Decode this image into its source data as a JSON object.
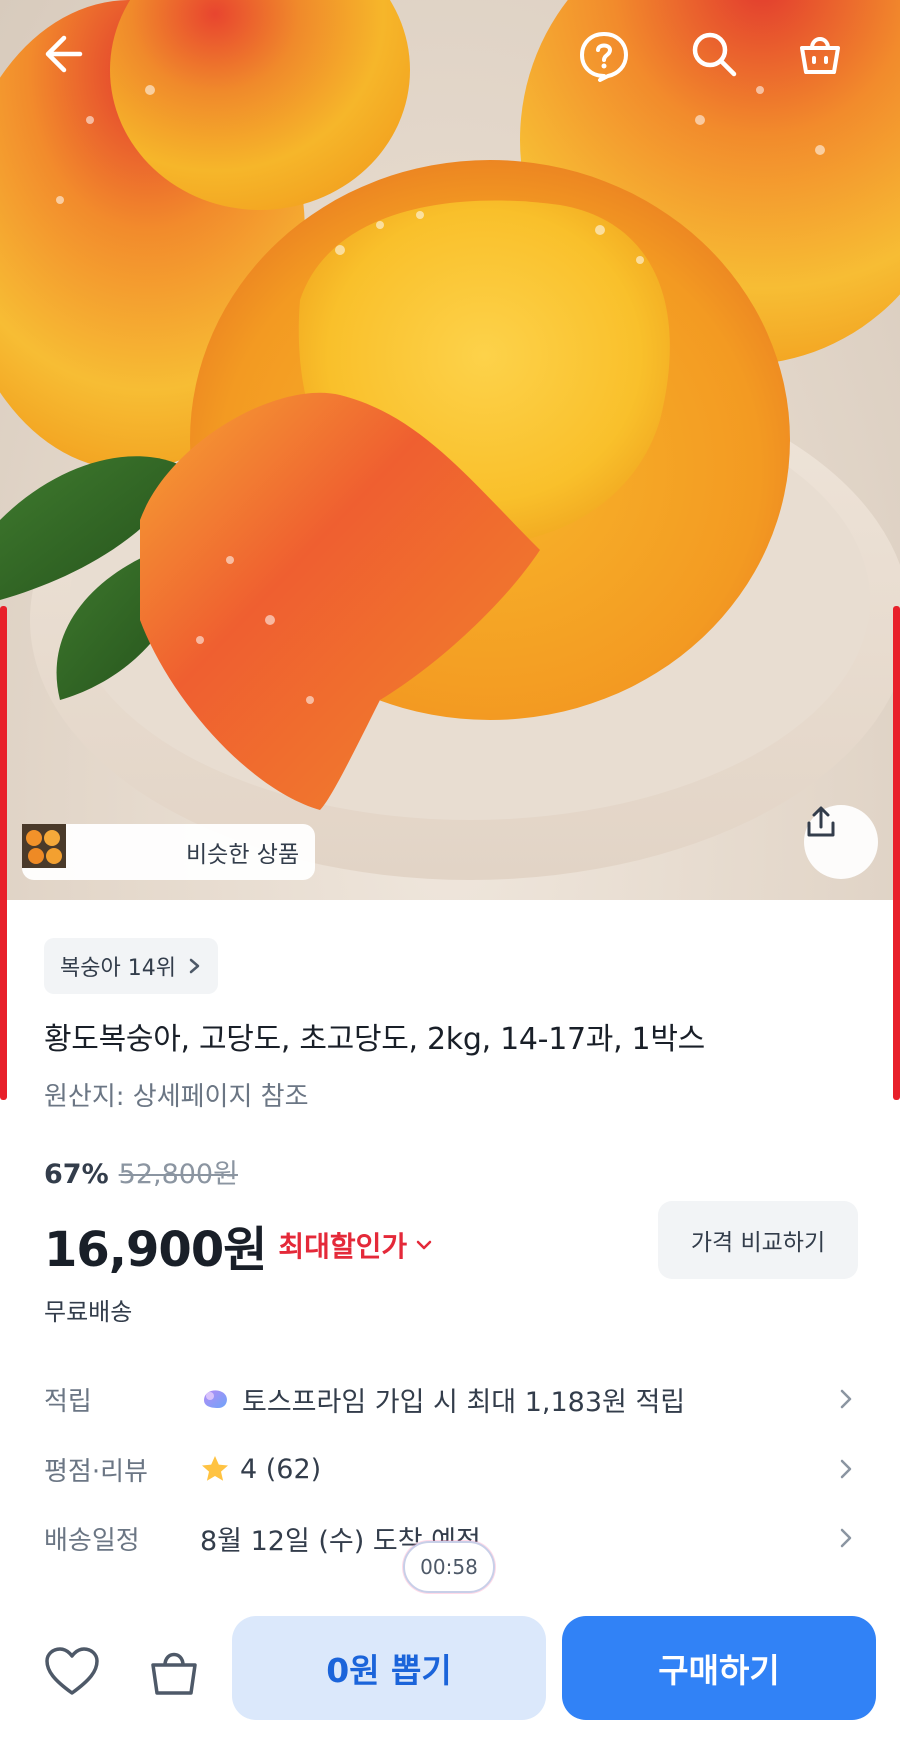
{
  "header": {
    "icons": [
      "back-arrow-icon",
      "help-icon",
      "search-icon",
      "cart-icon"
    ]
  },
  "hero": {
    "similar_label": "비슷한 상품",
    "share_icon": "share-icon"
  },
  "product": {
    "rank": "복숭아 14위",
    "title": "황도복숭아, 고당도, 초고당도, 2kg, 14-17과, 1박스",
    "origin": "원산지: 상세페이지 참조",
    "discount_rate": "67%",
    "original_price": "52,800원",
    "price": "16,900원",
    "max_discount_label": "최대할인가",
    "compare_label": "가격 비교하기",
    "shipping": "무료배송"
  },
  "details": {
    "points_label": "적립",
    "points_value": "토스프라임 가입 시 최대 1,183원 적립",
    "rating_label": "평점·리뷰",
    "rating_value": "4 (62)",
    "delivery_label": "배송일정",
    "delivery_value": "8월 12일 (수) 도착 예정"
  },
  "timer": "00:58",
  "bottom_bar": {
    "draw_label": "0원 뽑기",
    "buy_label": "구매하기"
  },
  "colors": {
    "accent": "#3182f6",
    "sale_red": "#e42939",
    "draw_bg": "#dbe8fb"
  }
}
